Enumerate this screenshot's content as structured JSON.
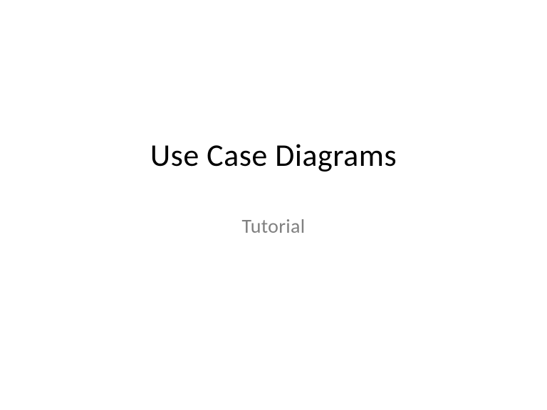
{
  "slide": {
    "title": "Use Case Diagrams",
    "subtitle": "Tutorial"
  }
}
